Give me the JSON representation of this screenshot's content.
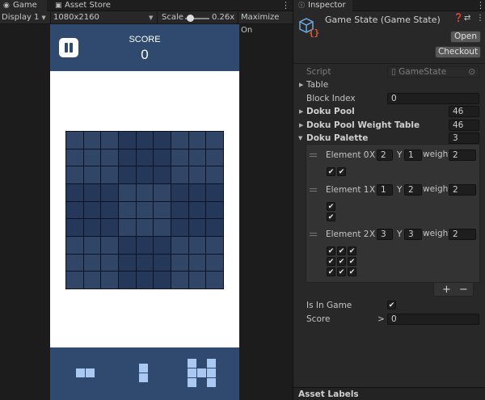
{
  "game_window": {
    "tabs": [
      {
        "label": "Game",
        "icon": "gamepad-icon"
      },
      {
        "label": "Asset Store",
        "icon": "store-icon"
      }
    ],
    "toolbar": {
      "display": "Display 1",
      "resolution": "1080x2160",
      "scale_label": "Scale",
      "scale_value": "0.26x",
      "maximize": "Maximize On"
    }
  },
  "game": {
    "score_label": "SCORE",
    "score_value": "0",
    "board_size": 9,
    "pieces": [
      {
        "name": "horizontal-domino",
        "rows": [
          "11"
        ]
      },
      {
        "name": "vertical-domino",
        "rows": [
          "1",
          "1"
        ]
      },
      {
        "name": "h-pentomino",
        "rows": [
          "101",
          "111",
          "101"
        ]
      }
    ],
    "colors": {
      "header": "#2f4a6e",
      "cell": "#314566",
      "piece": "#a9c8f2"
    }
  },
  "inspector": {
    "tab_label": "Inspector",
    "title": "Game State (Game State)",
    "open_button": "Open",
    "checkout_button": "Checkout",
    "script_label": "Script",
    "script_value": "GameState",
    "table_label": "Table",
    "block_index_label": "Block Index",
    "block_index_value": "0",
    "doku_pool_label": "Doku Pool",
    "doku_pool_value": "46",
    "doku_pool_weight_label": "Doku Pool Weight Table",
    "doku_pool_weight_value": "46",
    "doku_palette_label": "Doku Palette",
    "doku_palette_value": "3",
    "elements": [
      {
        "label": "Element 0",
        "x_label": "X",
        "x": "2",
        "y_label": "Y",
        "y": "1",
        "weight_label": "weight",
        "weight": "2"
      },
      {
        "label": "Element 1",
        "x_label": "X",
        "x": "1",
        "y_label": "Y",
        "y": "2",
        "weight_label": "weight",
        "weight": "2"
      },
      {
        "label": "Element 2",
        "x_label": "X",
        "x": "3",
        "y_label": "Y",
        "y": "3",
        "weight_label": "weight",
        "weight": "2"
      }
    ],
    "add_symbol": "+",
    "remove_symbol": "−",
    "is_in_game_label": "Is In Game",
    "is_in_game": true,
    "score_label": "Score",
    "score_value": "0",
    "asset_labels": "Asset Labels"
  }
}
